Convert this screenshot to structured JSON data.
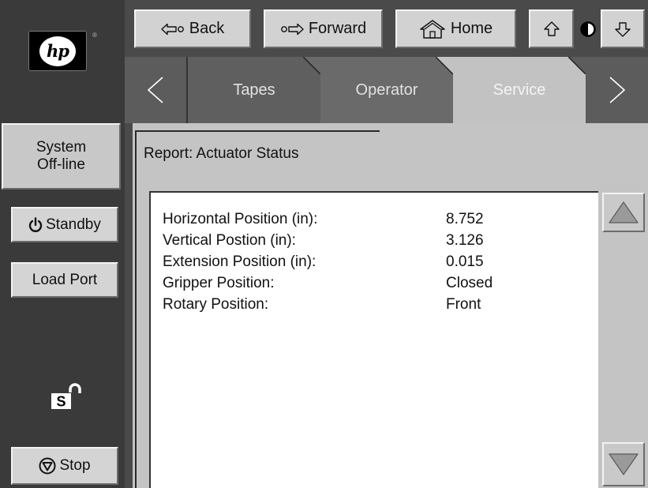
{
  "brand": {
    "logo_text": "hp",
    "registered_mark": "®"
  },
  "sidebar": {
    "status_line1": "System",
    "status_line2": "Off-line",
    "standby_label": "Standby",
    "load_port_label": "Load Port",
    "security_letter": "S",
    "stop_label": "Stop"
  },
  "nav": {
    "back_label": "Back",
    "forward_label": "Forward",
    "home_label": "Home"
  },
  "tabs": [
    {
      "label": "Tapes",
      "active": false
    },
    {
      "label": "Operator",
      "active": false
    },
    {
      "label": "Service",
      "active": true
    }
  ],
  "report": {
    "title": "Report: Actuator Status",
    "rows": [
      {
        "label": "Horizontal Position (in):",
        "value": "8.752"
      },
      {
        "label": "Vertical Postion (in):",
        "value": "3.126"
      },
      {
        "label": "Extension Position (in):",
        "value": "0.015"
      },
      {
        "label": "Gripper Position:",
        "value": "Closed"
      },
      {
        "label": "Rotary Position:",
        "value": "Front"
      }
    ]
  },
  "icons": {
    "back": "arrow-left-outline-icon",
    "forward": "arrow-right-outline-icon",
    "home": "home-icon",
    "up": "arrow-up-outline-icon",
    "contrast": "contrast-icon",
    "down": "arrow-down-outline-icon",
    "standby": "power-icon",
    "stop": "stop-icon",
    "security": "unlocked-padlock-icon",
    "scroll_up": "triangle-up-icon",
    "scroll_down": "triangle-down-icon"
  },
  "colors": {
    "sidebar_bg": "#3a3a3a",
    "topbar_bg": "#4a4a4a",
    "panel_bg": "#c4c4c4",
    "active_tab_bg": "#c2c2c2",
    "button_face": "#d2d2d2"
  }
}
